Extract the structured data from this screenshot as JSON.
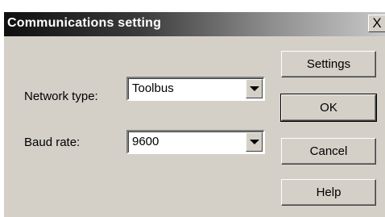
{
  "dialog": {
    "title": "Communications setting",
    "close_glyph": "X"
  },
  "fields": {
    "network_type": {
      "label": "Network type:",
      "value": "Toolbus"
    },
    "baud_rate": {
      "label": "Baud rate:",
      "value": "9600"
    }
  },
  "buttons": {
    "settings": "Settings",
    "ok": "OK",
    "cancel": "Cancel",
    "help": "Help"
  }
}
